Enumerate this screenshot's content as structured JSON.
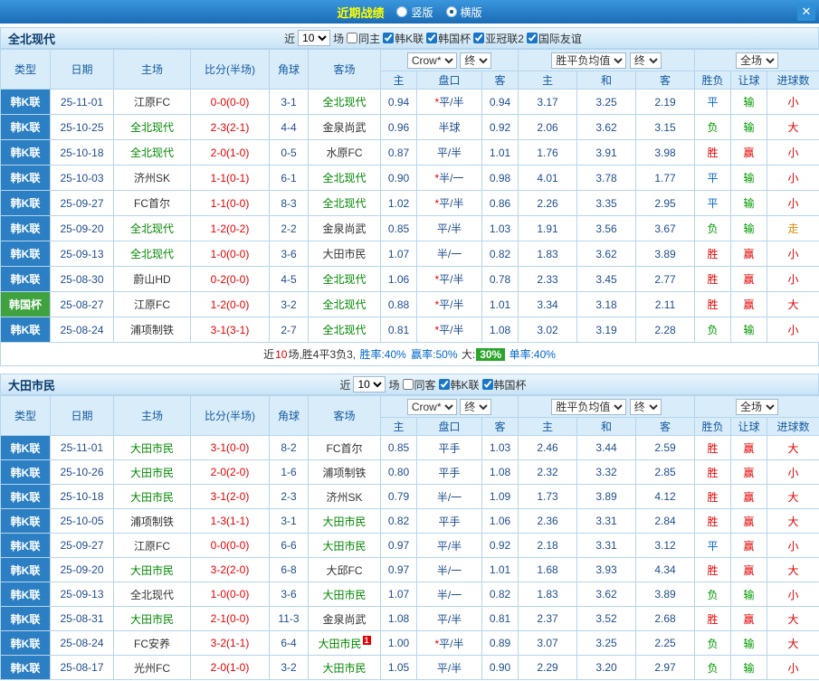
{
  "topbar": {
    "title": "近期战绩",
    "vertical_label": "竖版",
    "horizontal_label": "横版",
    "selected_layout": "横版",
    "close_icon": "✕"
  },
  "colors": {
    "topbar_blue": "#1a76c6",
    "header_light_blue": "#d9ecfa",
    "league_blue": "#2b7fc2",
    "cup_green": "#3fa23f",
    "focus_team_green": "#008800",
    "score_red": "#e60000",
    "odds_navy": "#1f4e8c",
    "win_red": "#e60000",
    "lose_green": "#009900",
    "draw_blue": "#0066cc",
    "walk_orange": "#e08a00",
    "summary_badge_green": "#2aa52a"
  },
  "table_headers": {
    "type": "类型",
    "date": "日期",
    "home": "主场",
    "score": "比分(半场)",
    "corner": "角球",
    "away": "客场",
    "odds_company": "Crow*",
    "final_label": "终",
    "europe_label": "胜平负均值",
    "scope_label": "全场",
    "sub": [
      "主",
      "盘口",
      "客",
      "主",
      "和",
      "客",
      "胜负",
      "让球",
      "进球数"
    ]
  },
  "sections": [
    {
      "team": "全北现代",
      "filter": {
        "near": "近",
        "count": "10",
        "unit": "场",
        "checks": [
          {
            "label": "同主",
            "checked": false
          },
          {
            "label": "韩K联",
            "checked": true
          },
          {
            "label": "韩国杯",
            "checked": true
          },
          {
            "label": "亚冠联2",
            "checked": true
          },
          {
            "label": "国际友谊",
            "checked": true
          }
        ]
      },
      "rows": [
        {
          "type": "韩K联",
          "typeCls": "blue",
          "date": "25-11-01",
          "home": "江原FC",
          "homeFocus": false,
          "score": "0-0(0-0)",
          "corner": "3-1",
          "away": "全北现代",
          "awayFocus": true,
          "awayBadge": "",
          "o1": "0.94",
          "star": "*",
          "hcap": "平/半",
          "o2": "0.94",
          "w": "3.17",
          "d": "3.25",
          "l": "2.19",
          "res": "平",
          "resCls": "blue",
          "hres": "输",
          "hresCls": "green",
          "goal": "小",
          "goalCls": "red"
        },
        {
          "type": "韩K联",
          "typeCls": "blue",
          "date": "25-10-25",
          "home": "全北现代",
          "homeFocus": true,
          "score": "2-3(2-1)",
          "corner": "4-4",
          "away": "金泉尚武",
          "awayFocus": false,
          "awayBadge": "",
          "o1": "0.96",
          "star": "",
          "hcap": "半球",
          "o2": "0.92",
          "w": "2.06",
          "d": "3.62",
          "l": "3.15",
          "res": "负",
          "resCls": "green",
          "hres": "输",
          "hresCls": "green",
          "goal": "大",
          "goalCls": "red"
        },
        {
          "type": "韩K联",
          "typeCls": "blue",
          "date": "25-10-18",
          "home": "全北现代",
          "homeFocus": true,
          "score": "2-0(1-0)",
          "corner": "0-5",
          "away": "水原FC",
          "awayFocus": false,
          "awayBadge": "",
          "o1": "0.87",
          "star": "",
          "hcap": "平/半",
          "o2": "1.01",
          "w": "1.76",
          "d": "3.91",
          "l": "3.98",
          "res": "胜",
          "resCls": "red",
          "hres": "赢",
          "hresCls": "red",
          "goal": "小",
          "goalCls": "red"
        },
        {
          "type": "韩K联",
          "typeCls": "blue",
          "date": "25-10-03",
          "home": "济州SK",
          "homeFocus": false,
          "score": "1-1(0-1)",
          "corner": "6-1",
          "away": "全北现代",
          "awayFocus": true,
          "awayBadge": "",
          "o1": "0.90",
          "star": "*",
          "hcap": "半/一",
          "o2": "0.98",
          "w": "4.01",
          "d": "3.78",
          "l": "1.77",
          "res": "平",
          "resCls": "blue",
          "hres": "输",
          "hresCls": "green",
          "goal": "小",
          "goalCls": "red"
        },
        {
          "type": "韩K联",
          "typeCls": "blue",
          "date": "25-09-27",
          "home": "FC首尔",
          "homeFocus": false,
          "score": "1-1(0-0)",
          "corner": "8-3",
          "away": "全北现代",
          "awayFocus": true,
          "awayBadge": "",
          "o1": "1.02",
          "star": "*",
          "hcap": "平/半",
          "o2": "0.86",
          "w": "2.26",
          "d": "3.35",
          "l": "2.95",
          "res": "平",
          "resCls": "blue",
          "hres": "输",
          "hresCls": "green",
          "goal": "小",
          "goalCls": "red"
        },
        {
          "type": "韩K联",
          "typeCls": "blue",
          "date": "25-09-20",
          "home": "全北现代",
          "homeFocus": true,
          "score": "1-2(0-2)",
          "corner": "2-2",
          "away": "金泉尚武",
          "awayFocus": false,
          "awayBadge": "",
          "o1": "0.85",
          "star": "",
          "hcap": "平/半",
          "o2": "1.03",
          "w": "1.91",
          "d": "3.56",
          "l": "3.67",
          "res": "负",
          "resCls": "green",
          "hres": "输",
          "hresCls": "green",
          "goal": "走",
          "goalCls": "orange"
        },
        {
          "type": "韩K联",
          "typeCls": "blue",
          "date": "25-09-13",
          "home": "全北现代",
          "homeFocus": true,
          "score": "1-0(0-0)",
          "corner": "3-6",
          "away": "大田市民",
          "awayFocus": false,
          "awayBadge": "",
          "o1": "1.07",
          "star": "",
          "hcap": "半/一",
          "o2": "0.82",
          "w": "1.83",
          "d": "3.62",
          "l": "3.89",
          "res": "胜",
          "resCls": "red",
          "hres": "赢",
          "hresCls": "red",
          "goal": "小",
          "goalCls": "red"
        },
        {
          "type": "韩K联",
          "typeCls": "blue",
          "date": "25-08-30",
          "home": "蔚山HD",
          "homeFocus": false,
          "score": "0-2(0-0)",
          "corner": "4-5",
          "away": "全北现代",
          "awayFocus": true,
          "awayBadge": "",
          "o1": "1.06",
          "star": "*",
          "hcap": "平/半",
          "o2": "0.78",
          "w": "2.33",
          "d": "3.45",
          "l": "2.77",
          "res": "胜",
          "resCls": "red",
          "hres": "赢",
          "hresCls": "red",
          "goal": "小",
          "goalCls": "red"
        },
        {
          "type": "韩国杯",
          "typeCls": "green",
          "date": "25-08-27",
          "home": "江原FC",
          "homeFocus": false,
          "score": "1-2(0-0)",
          "corner": "3-2",
          "away": "全北现代",
          "awayFocus": true,
          "awayBadge": "",
          "o1": "0.88",
          "star": "*",
          "hcap": "平/半",
          "o2": "1.01",
          "w": "3.34",
          "d": "3.18",
          "l": "2.11",
          "res": "胜",
          "resCls": "red",
          "hres": "赢",
          "hresCls": "red",
          "goal": "大",
          "goalCls": "red"
        },
        {
          "type": "韩K联",
          "typeCls": "blue",
          "date": "25-08-24",
          "home": "浦项制铁",
          "homeFocus": false,
          "score": "3-1(3-1)",
          "corner": "2-7",
          "away": "全北现代",
          "awayFocus": true,
          "awayBadge": "",
          "o1": "0.81",
          "star": "*",
          "hcap": "平/半",
          "o2": "1.08",
          "w": "3.02",
          "d": "3.19",
          "l": "2.28",
          "res": "负",
          "resCls": "green",
          "hres": "输",
          "hresCls": "green",
          "goal": "小",
          "goalCls": "red"
        }
      ],
      "summary": [
        {
          "text": "近",
          "cls": "t-dark"
        },
        {
          "text": "10",
          "cls": "t-red"
        },
        {
          "text": "场,胜4平3负3, ",
          "cls": "t-dark"
        },
        {
          "text": "胜率:40%",
          "cls": "t-blue"
        },
        {
          "text": " ",
          "cls": "t-dark"
        },
        {
          "text": "赢率:50%",
          "cls": "t-blue"
        },
        {
          "text": " 大:",
          "cls": "t-dark"
        },
        {
          "text": "30%",
          "cls": "t-green-badge"
        },
        {
          "text": " 单率:40%",
          "cls": "t-blue"
        }
      ]
    },
    {
      "team": "大田市民",
      "filter": {
        "near": "近",
        "count": "10",
        "unit": "场",
        "checks": [
          {
            "label": "同客",
            "checked": false
          },
          {
            "label": "韩K联",
            "checked": true
          },
          {
            "label": "韩国杯",
            "checked": true
          }
        ]
      },
      "rows": [
        {
          "type": "韩K联",
          "typeCls": "blue",
          "date": "25-11-01",
          "home": "大田市民",
          "homeFocus": true,
          "score": "3-1(0-0)",
          "corner": "8-2",
          "away": "FC首尔",
          "awayFocus": false,
          "awayBadge": "",
          "o1": "0.85",
          "star": "",
          "hcap": "平手",
          "o2": "1.03",
          "w": "2.46",
          "d": "3.44",
          "l": "2.59",
          "res": "胜",
          "resCls": "red",
          "hres": "赢",
          "hresCls": "red",
          "goal": "大",
          "goalCls": "red"
        },
        {
          "type": "韩K联",
          "typeCls": "blue",
          "date": "25-10-26",
          "home": "大田市民",
          "homeFocus": true,
          "score": "2-0(2-0)",
          "corner": "1-6",
          "away": "浦项制铁",
          "awayFocus": false,
          "awayBadge": "",
          "o1": "0.80",
          "star": "",
          "hcap": "平手",
          "o2": "1.08",
          "w": "2.32",
          "d": "3.32",
          "l": "2.85",
          "res": "胜",
          "resCls": "red",
          "hres": "赢",
          "hresCls": "red",
          "goal": "小",
          "goalCls": "red"
        },
        {
          "type": "韩K联",
          "typeCls": "blue",
          "date": "25-10-18",
          "home": "大田市民",
          "homeFocus": true,
          "score": "3-1(2-0)",
          "corner": "2-3",
          "away": "济州SK",
          "awayFocus": false,
          "awayBadge": "",
          "o1": "0.79",
          "star": "",
          "hcap": "半/一",
          "o2": "1.09",
          "w": "1.73",
          "d": "3.89",
          "l": "4.12",
          "res": "胜",
          "resCls": "red",
          "hres": "赢",
          "hresCls": "red",
          "goal": "大",
          "goalCls": "red"
        },
        {
          "type": "韩K联",
          "typeCls": "blue",
          "date": "25-10-05",
          "home": "浦项制铁",
          "homeFocus": false,
          "score": "1-3(1-1)",
          "corner": "3-1",
          "away": "大田市民",
          "awayFocus": true,
          "awayBadge": "",
          "o1": "0.82",
          "star": "",
          "hcap": "平手",
          "o2": "1.06",
          "w": "2.36",
          "d": "3.31",
          "l": "2.84",
          "res": "胜",
          "resCls": "red",
          "hres": "赢",
          "hresCls": "red",
          "goal": "大",
          "goalCls": "red"
        },
        {
          "type": "韩K联",
          "typeCls": "blue",
          "date": "25-09-27",
          "home": "江原FC",
          "homeFocus": false,
          "score": "0-0(0-0)",
          "corner": "6-6",
          "away": "大田市民",
          "awayFocus": true,
          "awayBadge": "",
          "o1": "0.97",
          "star": "",
          "hcap": "平/半",
          "o2": "0.92",
          "w": "2.18",
          "d": "3.31",
          "l": "3.12",
          "res": "平",
          "resCls": "blue",
          "hres": "赢",
          "hresCls": "red",
          "goal": "小",
          "goalCls": "red"
        },
        {
          "type": "韩K联",
          "typeCls": "blue",
          "date": "25-09-20",
          "home": "大田市民",
          "homeFocus": true,
          "score": "3-2(2-0)",
          "corner": "6-8",
          "away": "大邱FC",
          "awayFocus": false,
          "awayBadge": "",
          "o1": "0.97",
          "star": "",
          "hcap": "半/一",
          "o2": "1.01",
          "w": "1.68",
          "d": "3.93",
          "l": "4.34",
          "res": "胜",
          "resCls": "red",
          "hres": "赢",
          "hresCls": "red",
          "goal": "大",
          "goalCls": "red"
        },
        {
          "type": "韩K联",
          "typeCls": "blue",
          "date": "25-09-13",
          "home": "全北现代",
          "homeFocus": false,
          "score": "1-0(0-0)",
          "corner": "3-6",
          "away": "大田市民",
          "awayFocus": true,
          "awayBadge": "",
          "o1": "1.07",
          "star": "",
          "hcap": "半/一",
          "o2": "0.82",
          "w": "1.83",
          "d": "3.62",
          "l": "3.89",
          "res": "负",
          "resCls": "green",
          "hres": "输",
          "hresCls": "green",
          "goal": "小",
          "goalCls": "red"
        },
        {
          "type": "韩K联",
          "typeCls": "blue",
          "date": "25-08-31",
          "home": "大田市民",
          "homeFocus": true,
          "score": "2-1(0-0)",
          "corner": "11-3",
          "away": "金泉尚武",
          "awayFocus": false,
          "awayBadge": "",
          "o1": "1.08",
          "star": "",
          "hcap": "平/半",
          "o2": "0.81",
          "w": "2.37",
          "d": "3.52",
          "l": "2.68",
          "res": "胜",
          "resCls": "red",
          "hres": "赢",
          "hresCls": "red",
          "goal": "大",
          "goalCls": "red"
        },
        {
          "type": "韩K联",
          "typeCls": "blue",
          "date": "25-08-24",
          "home": "FC安养",
          "homeFocus": false,
          "score": "3-2(1-1)",
          "corner": "6-4",
          "away": "大田市民",
          "awayFocus": true,
          "awayBadge": "1",
          "o1": "1.00",
          "star": "*",
          "hcap": "平/半",
          "o2": "0.89",
          "w": "3.07",
          "d": "3.25",
          "l": "2.25",
          "res": "负",
          "resCls": "green",
          "hres": "输",
          "hresCls": "green",
          "goal": "大",
          "goalCls": "red"
        },
        {
          "type": "韩K联",
          "typeCls": "blue",
          "date": "25-08-17",
          "home": "光州FC",
          "homeFocus": false,
          "score": "2-0(1-0)",
          "corner": "3-2",
          "away": "大田市民",
          "awayFocus": true,
          "awayBadge": "",
          "o1": "1.05",
          "star": "",
          "hcap": "平/半",
          "o2": "0.90",
          "w": "2.29",
          "d": "3.20",
          "l": "2.97",
          "res": "负",
          "resCls": "green",
          "hres": "输",
          "hresCls": "green",
          "goal": "小",
          "goalCls": "red"
        }
      ],
      "summary": []
    }
  ]
}
